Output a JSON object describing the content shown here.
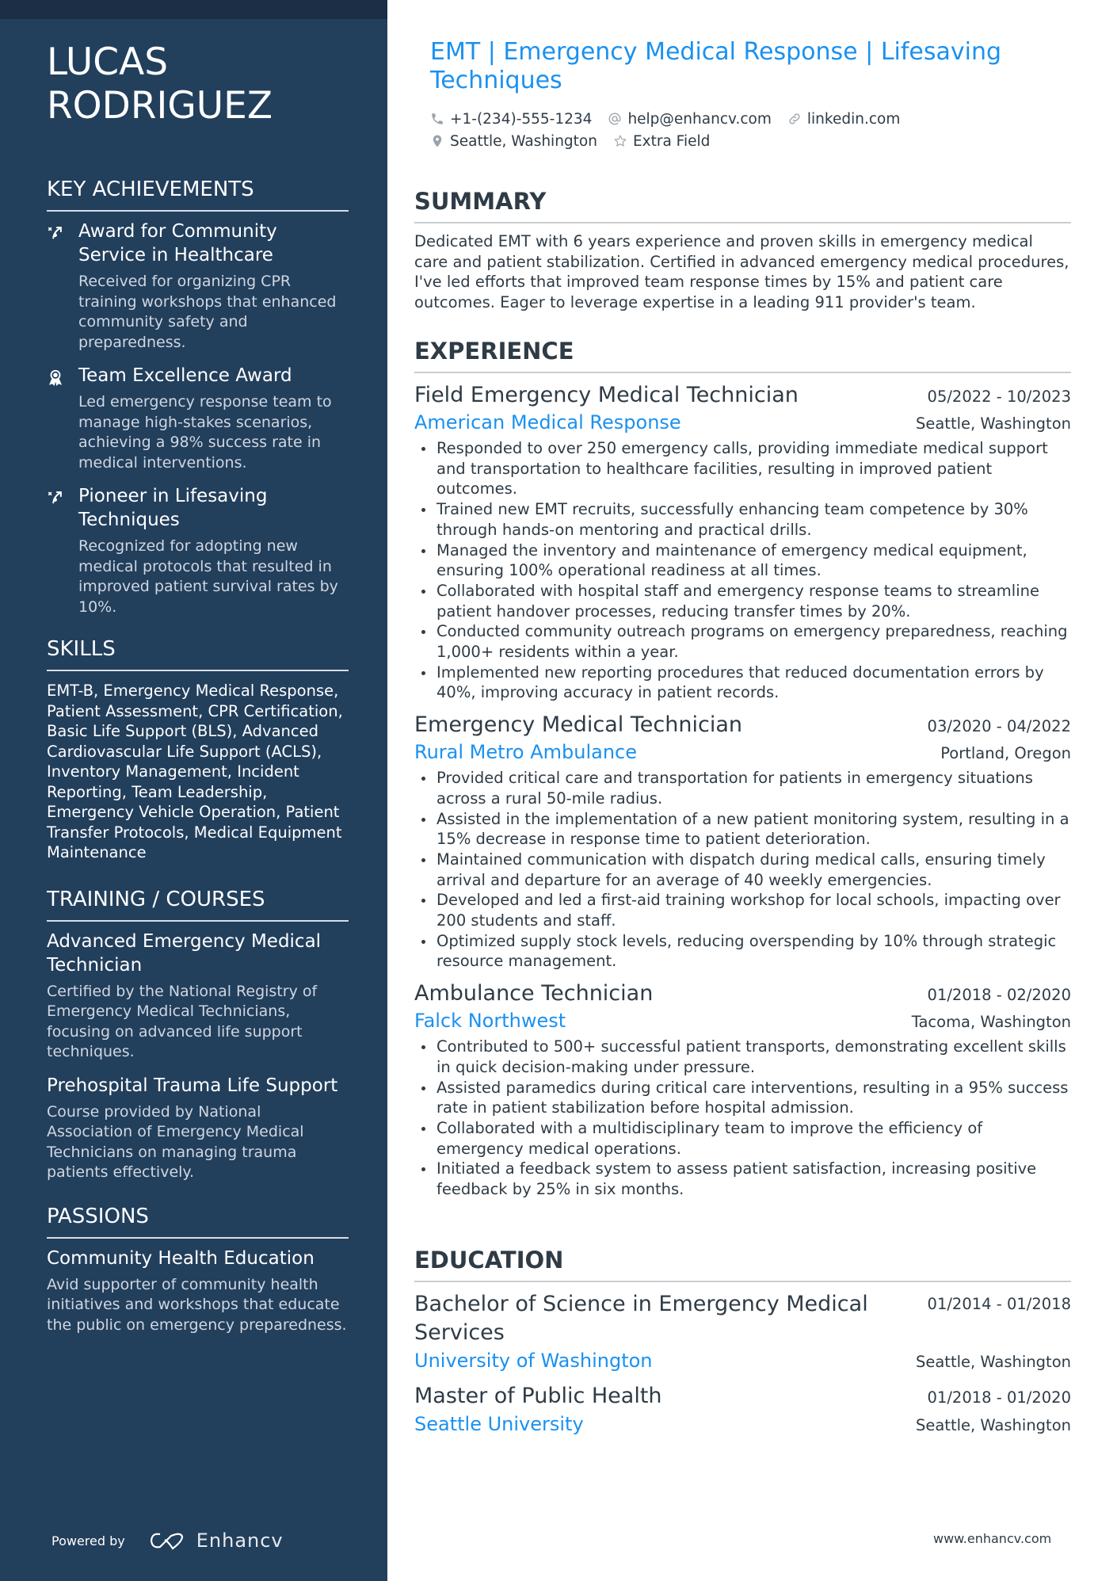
{
  "colors": {
    "sidebar": "#223f5c",
    "sidebar_top": "#1b2e45",
    "accent": "#1a91f0",
    "text": "#2f3b45"
  },
  "profile": {
    "name_line1": "LUCAS",
    "name_line2": "RODRIGUEZ",
    "headline": "EMT | Emergency Medical Response | Lifesaving Techniques",
    "phone": "+1-(234)-555-1234",
    "email": "help@enhancv.com",
    "link": "linkedin.com",
    "location": "Seattle, Washington",
    "extra": "Extra Field"
  },
  "sidebar": {
    "achievements_title": "KEY ACHIEVEMENTS",
    "achievements": [
      {
        "icon": "wand-icon",
        "title": "Award for Community Service in Healthcare",
        "desc": "Received for organizing CPR training workshops that enhanced community safety and preparedness."
      },
      {
        "icon": "medal-icon",
        "title": "Team Excellence Award",
        "desc": "Led emergency response team to manage high-stakes scenarios, achieving a 98% success rate in medical interventions."
      },
      {
        "icon": "wand-icon",
        "title": "Pioneer in Lifesaving Techniques",
        "desc": "Recognized for adopting new medical protocols that resulted in improved patient survival rates by 10%."
      }
    ],
    "skills_title": "SKILLS",
    "skills_text": "EMT-B, Emergency Medical Response, Patient Assessment, CPR Certification, Basic Life Support (BLS), Advanced Cardiovascular Life Support (ACLS), Inventory Management, Incident Reporting, Team Leadership, Emergency Vehicle Operation, Patient Transfer Protocols, Medical Equipment Maintenance",
    "training_title": "TRAINING / COURSES",
    "courses": [
      {
        "title": "Advanced Emergency Medical Technician",
        "desc": "Certified by the National Registry of Emergency Medical Technicians, focusing on advanced life support techniques."
      },
      {
        "title": "Prehospital Trauma Life Support",
        "desc": "Course provided by National Association of Emergency Medical Technicians on managing trauma patients effectively."
      }
    ],
    "passions_title": "PASSIONS",
    "passions": [
      {
        "title": "Community Health Education",
        "desc": "Avid supporter of community health initiatives and workshops that educate the public on emergency preparedness."
      }
    ],
    "powered_by": "Powered by",
    "brand": "Enhancv"
  },
  "main": {
    "summary_title": "SUMMARY",
    "summary": "Dedicated EMT with 6 years experience and proven skills in emergency medical care and patient stabilization. Certified in advanced emergency medical procedures, I've led efforts that improved team response times by 15% and patient care outcomes. Eager to leverage expertise in a leading 911 provider's team.",
    "experience_title": "EXPERIENCE",
    "jobs": [
      {
        "title": "Field Emergency Medical Technician",
        "dates": "05/2022 - 10/2023",
        "company": "American Medical Response",
        "location": "Seattle, Washington",
        "bullets": [
          "Responded to over 250 emergency calls, providing immediate medical support and transportation to healthcare facilities, resulting in improved patient outcomes.",
          "Trained new EMT recruits, successfully enhancing team competence by 30% through hands-on mentoring and practical drills.",
          "Managed the inventory and maintenance of emergency medical equipment, ensuring 100% operational readiness at all times.",
          "Collaborated with hospital staff and emergency response teams to streamline patient handover processes, reducing transfer times by 20%.",
          "Conducted community outreach programs on emergency preparedness, reaching 1,000+ residents within a year.",
          "Implemented new reporting procedures that reduced documentation errors by 40%, improving accuracy in patient records."
        ]
      },
      {
        "title": "Emergency Medical Technician",
        "dates": "03/2020 - 04/2022",
        "company": "Rural Metro Ambulance",
        "location": "Portland, Oregon",
        "bullets": [
          "Provided critical care and transportation for patients in emergency situations across a rural 50-mile radius.",
          "Assisted in the implementation of a new patient monitoring system, resulting in a 15% decrease in response time to patient deterioration.",
          "Maintained communication with dispatch during medical calls, ensuring timely arrival and departure for an average of 40 weekly emergencies.",
          "Developed and led a first-aid training workshop for local schools, impacting over 200 students and staff.",
          "Optimized supply stock levels, reducing overspending by 10% through strategic resource management."
        ]
      },
      {
        "title": "Ambulance Technician",
        "dates": "01/2018 - 02/2020",
        "company": "Falck Northwest",
        "location": "Tacoma, Washington",
        "bullets": [
          "Contributed to 500+ successful patient transports, demonstrating excellent skills in quick decision-making under pressure.",
          "Assisted paramedics during critical care interventions, resulting in a 95% success rate in patient stabilization before hospital admission.",
          "Collaborated with a multidisciplinary team to improve the efficiency of emergency medical operations.",
          "Initiated a feedback system to assess patient satisfaction, increasing positive feedback by 25% in six months."
        ]
      }
    ],
    "education_title": "EDUCATION",
    "education": [
      {
        "degree": "Bachelor of Science in Emergency Medical Services",
        "dates": "01/2014 - 01/2018",
        "school": "University of Washington",
        "location": "Seattle, Washington"
      },
      {
        "degree": "Master of Public Health",
        "dates": "01/2018 - 01/2020",
        "school": "Seattle University",
        "location": "Seattle, Washington"
      }
    ],
    "footer_url": "www.enhancv.com"
  }
}
